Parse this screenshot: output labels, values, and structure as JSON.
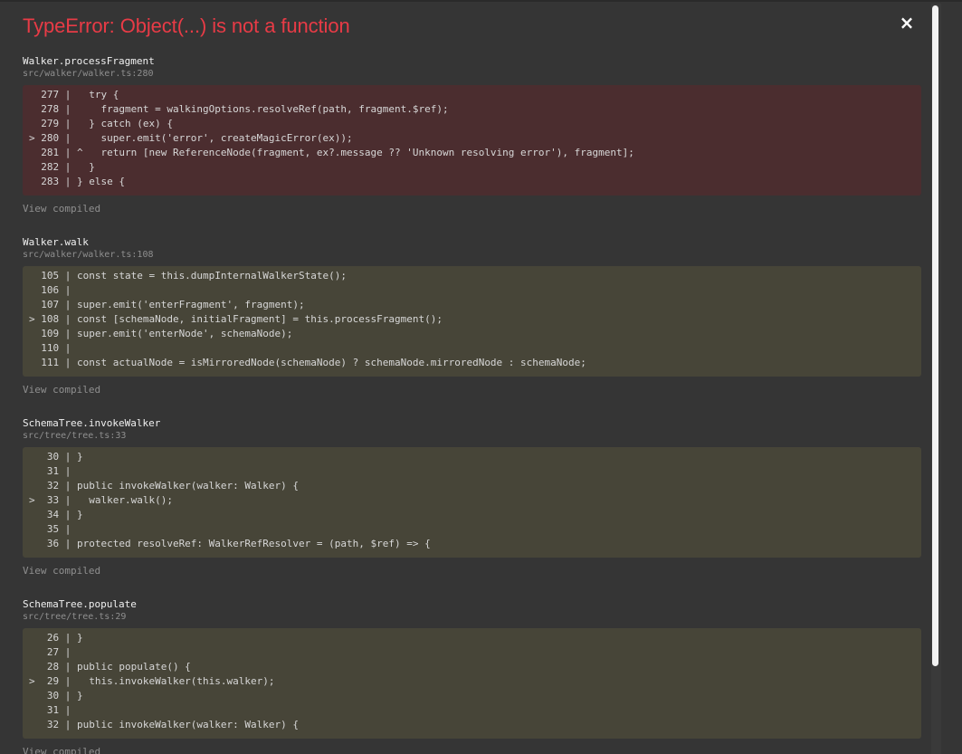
{
  "error": {
    "title": "TypeError: Object(...) is not a function",
    "close_label": "×"
  },
  "frames": [
    {
      "function": "Walker.processFragment",
      "file": "src/walker/walker.ts:280",
      "type": "error",
      "lines": [
        "  277 |   try {",
        "  278 |     fragment = walkingOptions.resolveRef(path, fragment.$ref);",
        "  279 |   } catch (ex) {",
        "> 280 |     super.emit('error', createMagicError(ex));",
        "  281 | ^   return [new ReferenceNode(fragment, ex?.message ?? 'Unknown resolving error'), fragment];",
        "  282 |   }",
        "  283 | } else {"
      ],
      "view_compiled": "View compiled"
    },
    {
      "function": "Walker.walk",
      "file": "src/walker/walker.ts:108",
      "type": "normal",
      "lines": [
        "  105 | const state = this.dumpInternalWalkerState();",
        "  106 |",
        "  107 | super.emit('enterFragment', fragment);",
        "> 108 | const [schemaNode, initialFragment] = this.processFragment();",
        "  109 | super.emit('enterNode', schemaNode);",
        "  110 |",
        "  111 | const actualNode = isMirroredNode(schemaNode) ? schemaNode.mirroredNode : schemaNode;"
      ],
      "view_compiled": "View compiled"
    },
    {
      "function": "SchemaTree.invokeWalker",
      "file": "src/tree/tree.ts:33",
      "type": "normal",
      "lines": [
        "   30 | }",
        "   31 |",
        "   32 | public invokeWalker(walker: Walker) {",
        ">  33 |   walker.walk();",
        "   34 | }",
        "   35 |",
        "   36 | protected resolveRef: WalkerRefResolver = (path, $ref) => {"
      ],
      "view_compiled": "View compiled"
    },
    {
      "function": "SchemaTree.populate",
      "file": "src/tree/tree.ts:29",
      "type": "normal",
      "lines": [
        "   26 | }",
        "   27 |",
        "   28 | public populate() {",
        ">  29 |   this.invokeWalker(this.walker);",
        "   30 | }",
        "   31 |",
        "   32 | public invokeWalker(walker: Walker) {"
      ],
      "view_compiled": "View compiled"
    }
  ],
  "colors": {
    "title": "#e83b46",
    "error_box": "#4b2d2f",
    "normal_box": "#474538",
    "background": "#353535"
  }
}
